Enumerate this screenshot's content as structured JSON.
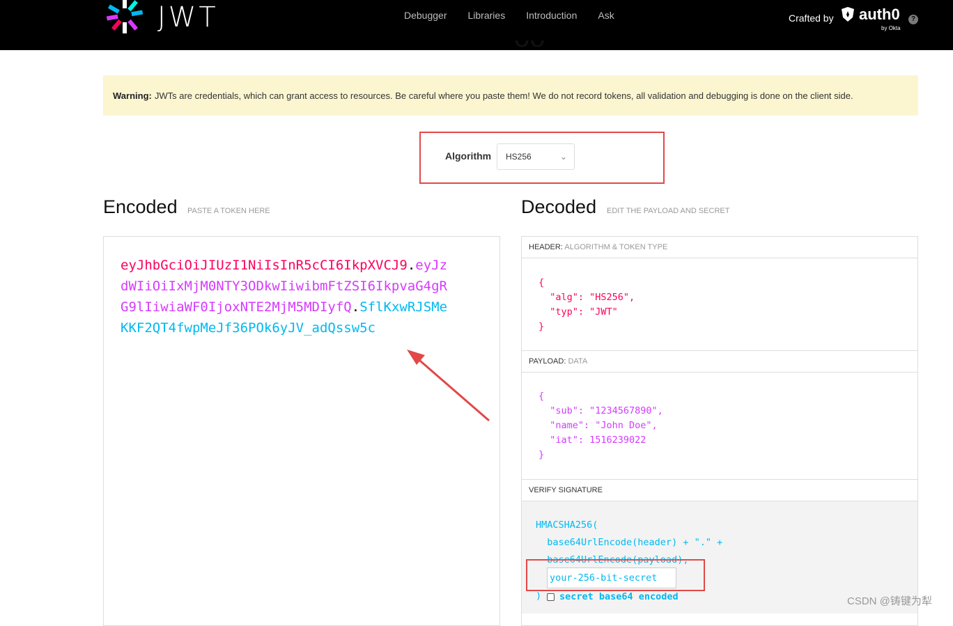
{
  "nav": {
    "logo_text": "JWT",
    "links": [
      "Debugger",
      "Libraries",
      "Introduction",
      "Ask"
    ],
    "crafted_by": "Crafted by",
    "brand": "auth0",
    "brand_sub": "by Okta",
    "help": "?"
  },
  "warning": {
    "label": "Warning:",
    "text": "JWTs are credentials, which can grant access to resources. Be careful where you paste them! We do not record tokens, all validation and debugging is done on the client side."
  },
  "algorithm": {
    "label": "Algorithm",
    "selected": "HS256"
  },
  "encoded": {
    "title": "Encoded",
    "subtitle": "PASTE A TOKEN HERE",
    "token_header": "eyJhbGciOiJIUzI1NiIsInR5cCI6IkpXVCJ9",
    "token_payload": "eyJzdWIiOiIxMjM0NTY3ODkwIiwibmFtZSI6IkpvaG4gRG9lIiwiaWF0IjoxNTE2MjM5MDIyfQ",
    "token_signature": "SflKxwRJSMeKKF2QT4fwpMeJf36POk6yJV_adQssw5c",
    "dot": "."
  },
  "decoded": {
    "title": "Decoded",
    "subtitle": "EDIT THE PAYLOAD AND SECRET",
    "header": {
      "label": "HEADER:",
      "sublabel": "ALGORITHM & TOKEN TYPE",
      "code": "{\n  \"alg\": \"HS256\",\n  \"typ\": \"JWT\"\n}"
    },
    "payload": {
      "label": "PAYLOAD:",
      "sublabel": "DATA",
      "code": "{\n  \"sub\": \"1234567890\",\n  \"name\": \"John Doe\",\n  \"iat\": 1516239022\n}"
    },
    "signature": {
      "label": "VERIFY SIGNATURE",
      "code": "HMACSHA256(\n  base64UrlEncode(header) + \".\" +\n  base64UrlEncode(payload),",
      "secret_value": "your-256-bit-secret",
      "close": ")",
      "checkbox_label": "secret base64 encoded"
    }
  },
  "watermark": "CSDN @铸键为犁"
}
